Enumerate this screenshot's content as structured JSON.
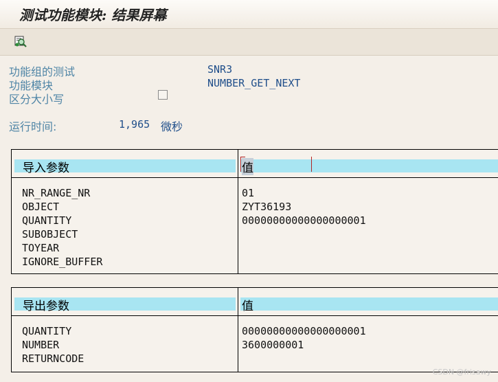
{
  "title": "测试功能模块: 结果屏幕",
  "toolbar": {
    "execute_icon": "execute-search-icon"
  },
  "info": {
    "function_group_label": "功能组的测试",
    "function_group_value": "SNR3",
    "function_module_label": "功能模块",
    "function_module_value": "NUMBER_GET_NEXT",
    "case_sensitive_label": "区分大小写",
    "case_sensitive_checked": false,
    "runtime_label": "运行时间:",
    "runtime_value": "1,965",
    "runtime_unit": "微秒"
  },
  "import_params": {
    "header_name": "导入参数",
    "header_value": "值",
    "names": [
      "NR_RANGE_NR",
      "OBJECT",
      "QUANTITY",
      "SUBOBJECT",
      "TOYEAR",
      "IGNORE_BUFFER"
    ],
    "values": [
      "01",
      "ZYT36193",
      "00000000000000000001",
      "",
      "",
      ""
    ]
  },
  "export_params": {
    "header_name": "导出参数",
    "header_value": "值",
    "names": [
      "QUANTITY",
      "NUMBER",
      "RETURNCODE"
    ],
    "values": [
      "00000000000000000001",
      "3600000001",
      ""
    ]
  },
  "watermark": "CSDN @frisawy",
  "colors": {
    "header_band": "#a8e5f2",
    "label_blue": "#4f85a6",
    "value_blue": "#1f4e8a"
  }
}
